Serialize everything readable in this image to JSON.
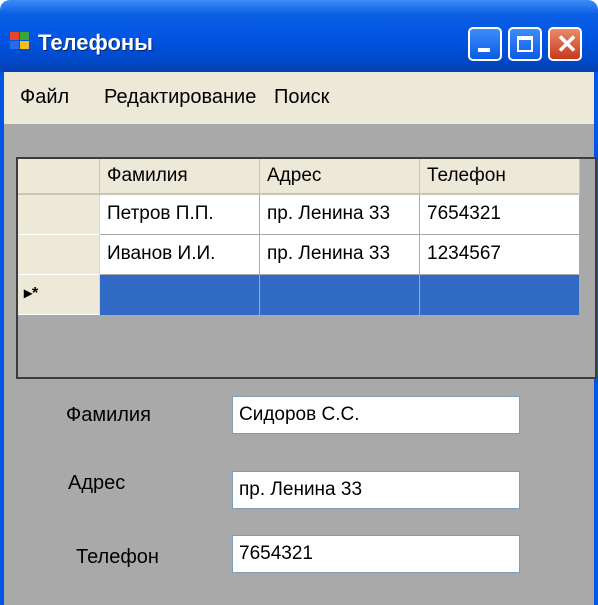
{
  "window": {
    "title": "Телефоны",
    "close_glyph": "✕"
  },
  "menu": {
    "items": [
      "Файл",
      "Редактирование",
      "Поиск"
    ]
  },
  "grid": {
    "columns": [
      "Фамилия",
      "Адрес",
      "Телефон"
    ],
    "rows": [
      [
        "Петров П.П.",
        "пр. Ленина 33",
        "7654321"
      ],
      [
        "Иванов И.И.",
        "пр. Ленина 33",
        "1234567"
      ]
    ],
    "new_row_marker": "▸*"
  },
  "form": {
    "surname_label": "Фамилия",
    "surname_value": "Сидоров С.С.",
    "address_label": "Адрес",
    "address_value": "пр. Ленина 33",
    "phone_label": "Телефон",
    "phone_value": "7654321"
  },
  "colors": {
    "titlebar": "#0054e3",
    "selection": "#316ac5",
    "client": "#a9a9a9",
    "menubar": "#ece9d8"
  }
}
